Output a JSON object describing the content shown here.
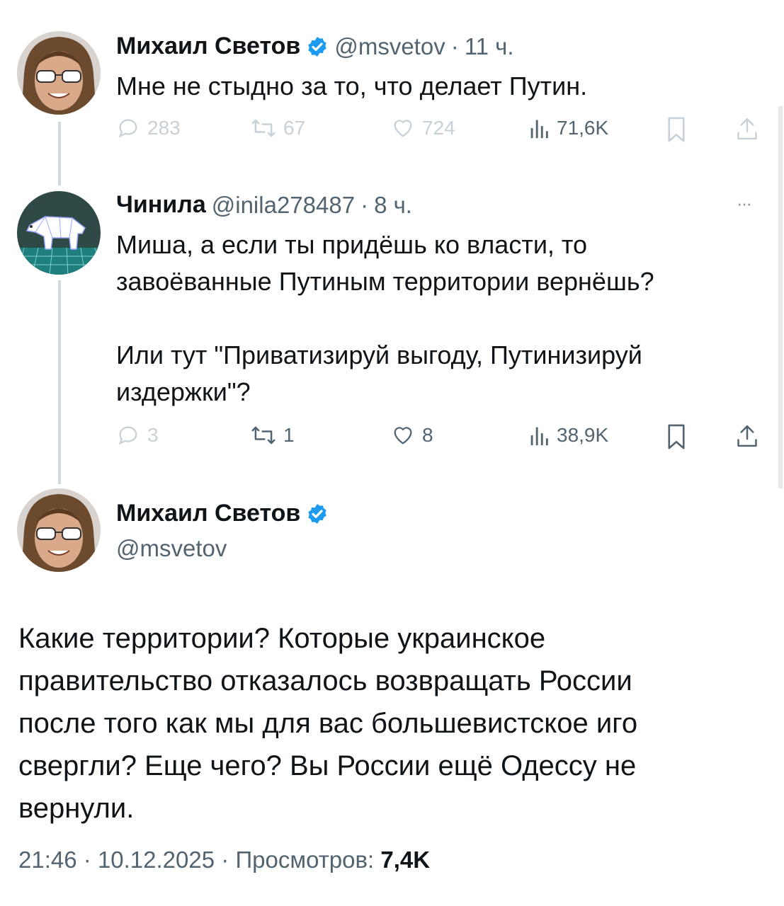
{
  "tweets": [
    {
      "author": "Михаил Светов",
      "handle": "@msvetov",
      "time": "11 ч.",
      "text": "Мне не стыдно за то, что делает Путин.",
      "replies": "283",
      "reposts": "67",
      "likes": "724",
      "views": "71,6K"
    },
    {
      "author": "Чинила",
      "handle": "@inila278487",
      "time": "8 ч.",
      "text": "Миша, а если ты придёшь ко власти, то\nзавоёванные Путиным территории вернёшь?\n\nИли тут \"Приватизируй выгоду, Путинизируй\nиздержки\"?",
      "replies": "3",
      "reposts": "1",
      "likes": "8",
      "views": "38,9K"
    }
  ],
  "main": {
    "author": "Михаил Светов",
    "handle": "@msvetov",
    "text": "Какие территории? Которые украинское\nправительство отказалось возвращать России\nпосле того как мы для вас большевистское иго\nсвергли? Еще чего? Вы России ещё Одессу не\nвернули.",
    "time": "21:46",
    "date": "10.12.2025",
    "views_label": "Просмотров:",
    "views": "7,4K"
  },
  "separator": "·",
  "more_glyph": "···",
  "colors": {
    "verified": "#1d9bf0",
    "secondary": "#536471",
    "thread_line": "#cfd9de"
  },
  "icons": [
    "verified-badge-icon",
    "reply-icon",
    "repost-icon",
    "like-icon",
    "views-icon",
    "bookmark-icon",
    "share-icon",
    "more-icon"
  ]
}
